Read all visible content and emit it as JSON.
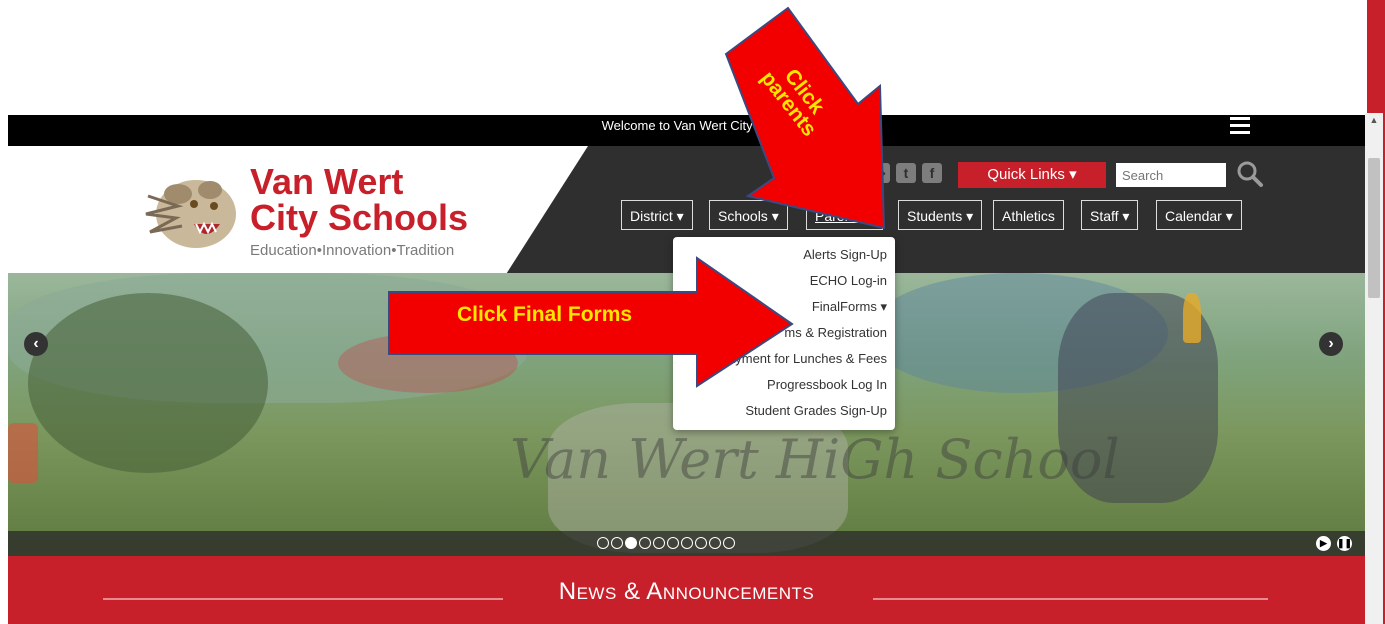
{
  "topbar": {
    "welcome": "Welcome to Van Wert City Sc"
  },
  "brand": {
    "line1": "Van Wert",
    "line2": "City Schools",
    "tagline": "Education•Innovation•Tradition"
  },
  "header": {
    "quick_links": "Quick Links ▾",
    "search_placeholder": "Search",
    "nav": [
      {
        "label": "District ▾"
      },
      {
        "label": "Schools ▾"
      },
      {
        "label": "Parents ▾"
      },
      {
        "label": "Students ▾"
      },
      {
        "label": "Athletics"
      },
      {
        "label": "Staff ▾"
      },
      {
        "label": "Calendar ▾"
      }
    ]
  },
  "dropdown": {
    "items": [
      {
        "label": "Alerts Sign-Up"
      },
      {
        "label": "ECHO Log-in"
      },
      {
        "label": "FinalForms ▾"
      },
      {
        "label": "ms & Registration"
      },
      {
        "label": "Payment for Lunches & Fees"
      },
      {
        "label": "Progressbook Log In"
      },
      {
        "label": "Student Grades Sign-Up"
      }
    ]
  },
  "hero": {
    "watermark": "Van Wert HiGh School",
    "slide_count": 10,
    "active_slide": 3
  },
  "news": {
    "title": "News & Announcements"
  },
  "annotations": {
    "arrow_left": "Click Final Forms",
    "arrow_top": "Click parents"
  },
  "colors": {
    "brand_red": "#c8202a",
    "header_dark": "#2f2f2f",
    "arrow_red": "#f20000",
    "arrow_text": "#ffe600"
  }
}
